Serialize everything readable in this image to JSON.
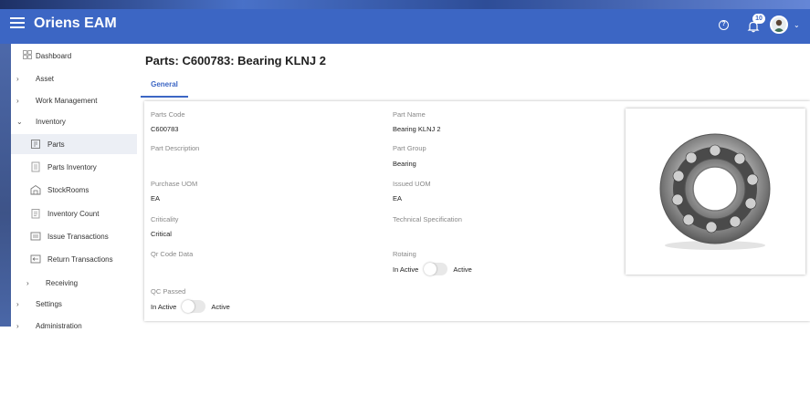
{
  "app": {
    "title": "Oriens EAM",
    "notification_count": "10"
  },
  "sidebar": {
    "items": [
      {
        "label": "Dashboard"
      },
      {
        "label": "Asset"
      },
      {
        "label": "Work Management"
      },
      {
        "label": "Inventory"
      },
      {
        "label": "Parts"
      },
      {
        "label": "Parts Inventory"
      },
      {
        "label": "StockRooms"
      },
      {
        "label": "Inventory Count"
      },
      {
        "label": "Issue Transactions"
      },
      {
        "label": "Return Transactions"
      },
      {
        "label": "Receiving"
      },
      {
        "label": "Settings"
      },
      {
        "label": "Administration"
      }
    ]
  },
  "page": {
    "title": "Parts: C600783: Bearing KLNJ 2",
    "tabs": [
      {
        "label": "General"
      }
    ]
  },
  "form": {
    "parts_code_label": "Parts Code",
    "parts_code": "C600783",
    "part_name_label": "Part Name",
    "part_name": "Bearing KLNJ 2",
    "part_description_label": "Part Description",
    "part_group_label": "Part Group",
    "part_group": "Bearing",
    "purchase_uom_label": "Purchase UOM",
    "purchase_uom": "EA",
    "issued_uom_label": "Issued UOM",
    "issued_uom": "EA",
    "criticality_label": "Criticality",
    "criticality": "Critical",
    "technical_spec_label": "Technical Specification",
    "qr_code_label": "Qr Code Data",
    "rotating_label": "Rotaing",
    "rotating_off": "In Active",
    "rotating_on": "Active",
    "qc_passed_label": "QC Passed",
    "qc_off": "In Active",
    "qc_on": "Active"
  }
}
